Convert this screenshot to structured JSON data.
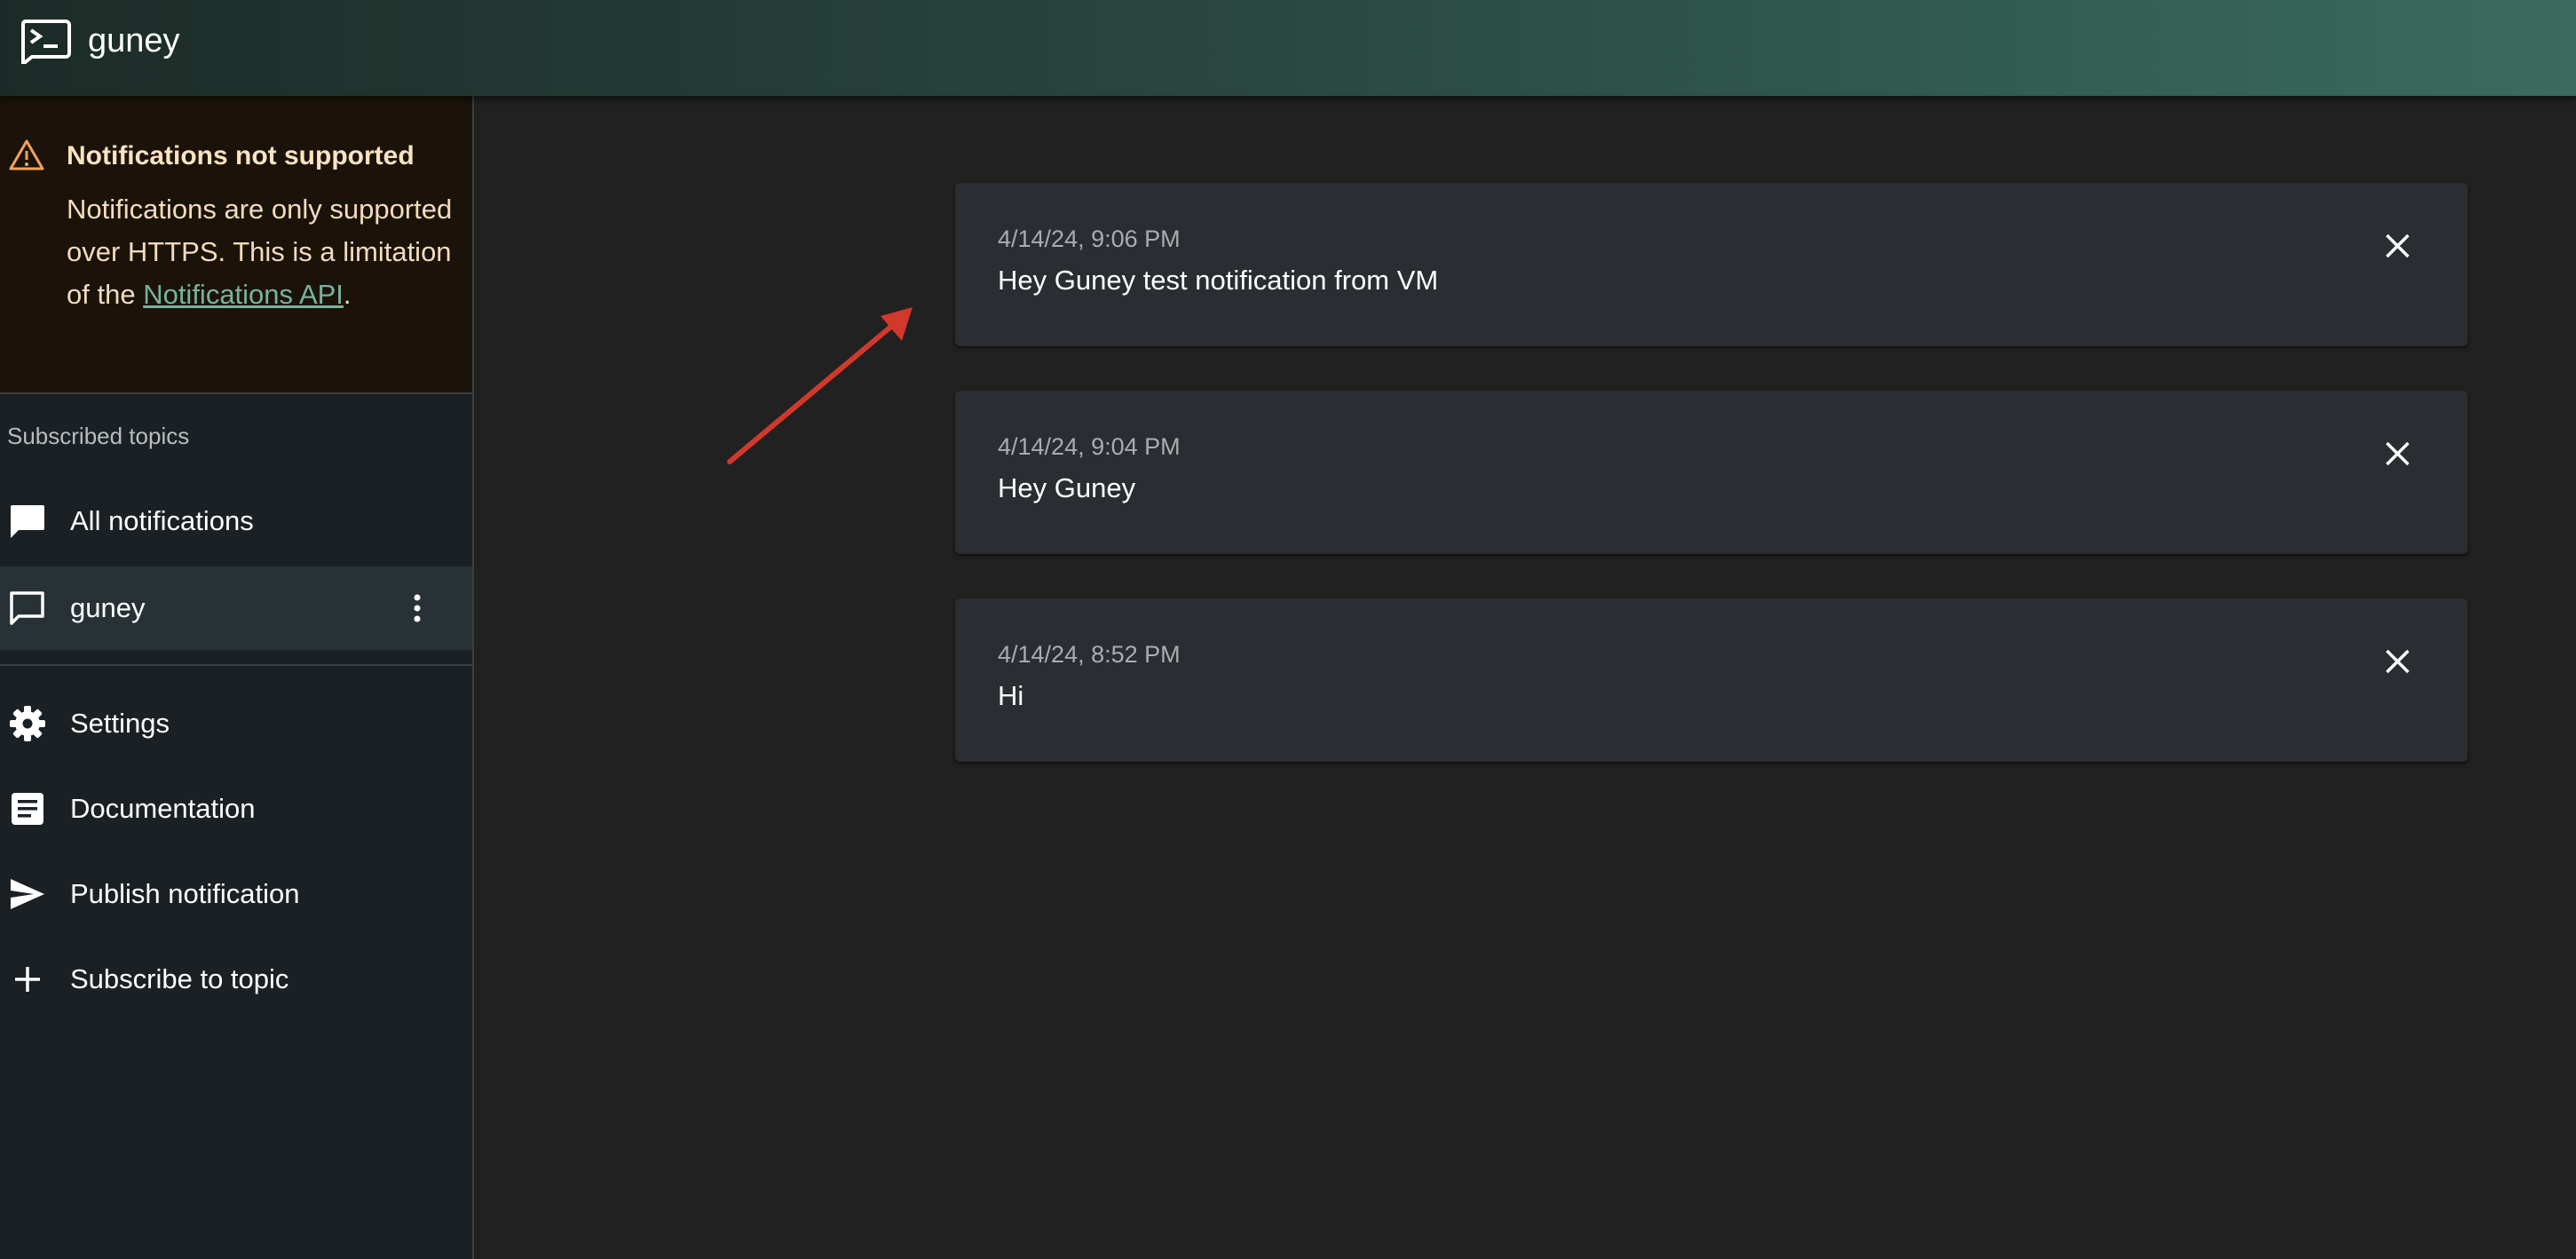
{
  "header": {
    "title": "guney"
  },
  "alert": {
    "title": "Notifications not supported",
    "body": "Notifications are only supported over HTTPS. This is a limitation of the ",
    "link": "Notifications API",
    "suffix": "."
  },
  "sidebar": {
    "section_label": "Subscribed topics",
    "topics": [
      {
        "label": "All notifications",
        "icon": "chat-bubble-filled-icon"
      },
      {
        "label": "guney",
        "icon": "chat-bubble-outline-icon",
        "selected": true
      }
    ],
    "links": [
      {
        "label": "Settings",
        "icon": "gear-icon"
      },
      {
        "label": "Documentation",
        "icon": "document-icon"
      },
      {
        "label": "Publish notification",
        "icon": "send-icon"
      },
      {
        "label": "Subscribe to topic",
        "icon": "plus-icon"
      }
    ]
  },
  "notifications": [
    {
      "time": "4/14/24, 9:06 PM",
      "message": "Hey Guney test notification from VM"
    },
    {
      "time": "4/14/24, 9:04 PM",
      "message": "Hey Guney"
    },
    {
      "time": "4/14/24, 8:52 PM",
      "message": "Hi"
    }
  ],
  "colors": {
    "accent": "#3a6b5e",
    "warning": "#f0a35e",
    "link": "#77b39f",
    "annotation_arrow": "#d0392b"
  }
}
